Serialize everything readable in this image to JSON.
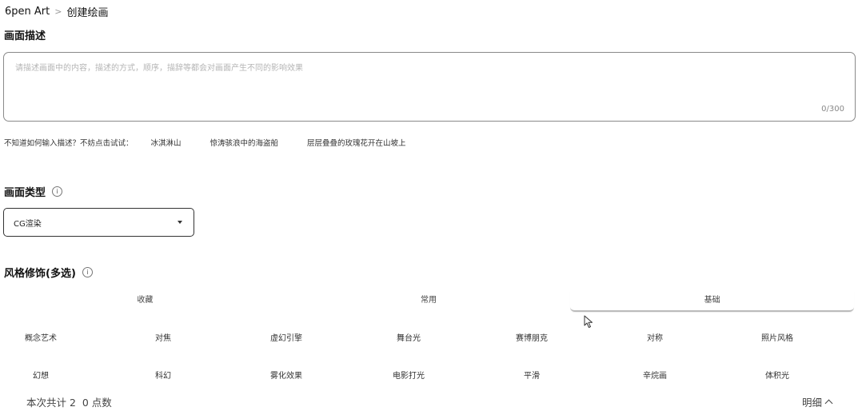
{
  "breadcrumb": {
    "root": "6pen Art",
    "separator": ">",
    "current": "创建绘画"
  },
  "description": {
    "title": "画面描述",
    "placeholder": "请描述画面中的内容，描述的方式，顺序，描辞等都会对画面产生不同的影响效果",
    "value": "",
    "counter": "0/300"
  },
  "suggestions": {
    "hint": "不知道如何输入描述？不妨点击试试：",
    "chips": [
      "冰淇淋山",
      "惊涛骇浪中的海盗船",
      "层层叠叠的玫瑰花开在山坡上"
    ]
  },
  "type_section": {
    "title": "画面类型",
    "info_icon": "info-icon",
    "selected": "CG渲染"
  },
  "style_section": {
    "title": "风格修饰(多选)",
    "info_icon": "info-icon",
    "tabs": [
      "收藏",
      "常用",
      "基础"
    ],
    "active_tab": "基础",
    "row1": [
      "概念艺术",
      "对焦",
      "虚幻引擎",
      "舞台光",
      "赛博朋克",
      "对称",
      "照片风格"
    ],
    "row2": [
      "幻想",
      "科幻",
      "雾化效果",
      "电影打光",
      "平滑",
      "辛烷画",
      "体积光"
    ]
  },
  "footer": {
    "summary": "本次共计 2  0 点数",
    "details": "明细"
  }
}
